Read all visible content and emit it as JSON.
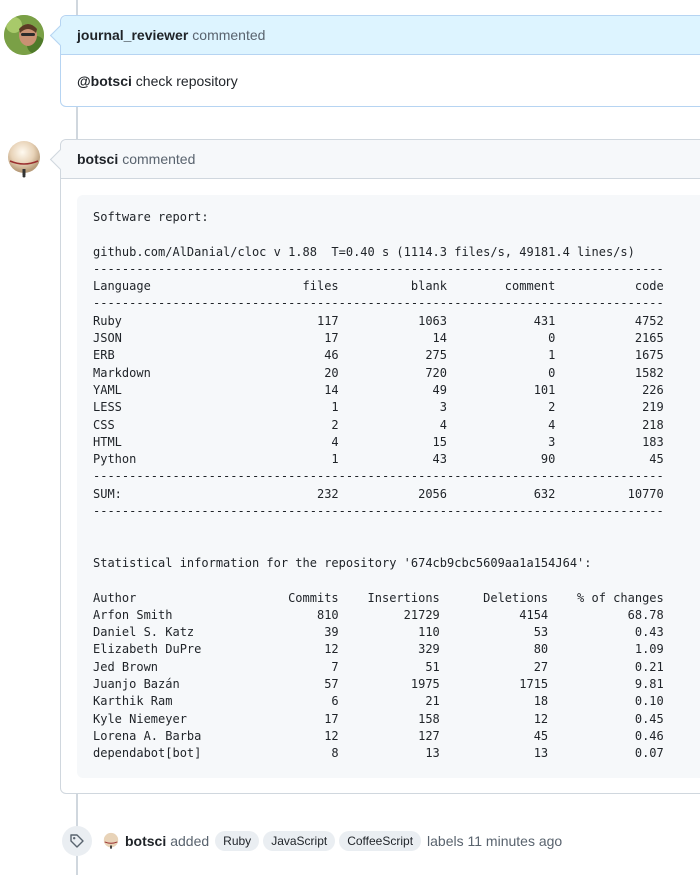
{
  "comments": [
    {
      "author": "journal_reviewer",
      "action": "commented",
      "mention": "@botsci",
      "text": " check repository"
    },
    {
      "author": "botsci",
      "action": "commented"
    }
  ],
  "report": {
    "lines": [
      "Software report:",
      "",
      "github.com/AlDanial/cloc v 1.88  T=0.40 s (1114.3 files/s, 49181.4 lines/s)",
      "-------------------------------------------------------------------------------",
      "Language                     files          blank        comment           code",
      "-------------------------------------------------------------------------------",
      "Ruby                           117           1063            431           4752",
      "JSON                            17             14              0           2165",
      "ERB                             46            275              1           1675",
      "Markdown                        20            720              0           1582",
      "YAML                            14             49            101            226",
      "LESS                             1              3              2            219",
      "CSS                              2              4              4            218",
      "HTML                             4             15              3            183",
      "Python                           1             43             90             45",
      "-------------------------------------------------------------------------------",
      "SUM:                           232           2056            632          10770",
      "-------------------------------------------------------------------------------",
      "",
      "",
      "Statistical information for the repository '674cb9cbc5609aa1a154J64':",
      "",
      "Author                     Commits    Insertions      Deletions    % of changes",
      "Arfon Smith                    810         21729           4154           68.78",
      "Daniel S. Katz                  39           110             53            0.43",
      "Elizabeth DuPre                 12           329             80            1.09",
      "Jed Brown                        7            51             27            0.21",
      "Juanjo Bazán                    57          1975           1715            9.81",
      "Karthik Ram                      6            21             18            0.10",
      "Kyle Niemeyer                   17           158             12            0.45",
      "Lorena A. Barba                 12           127             45            0.46",
      "dependabot[bot]                  8            13             13            0.07"
    ]
  },
  "event": {
    "author": "botsci",
    "action": "added",
    "labels": [
      "Ruby",
      "JavaScript",
      "CoffeeScript"
    ],
    "tail": "labels 11 minutes ago",
    "icon": "tag-icon"
  },
  "colors": {
    "highlight_header": "#ddf4ff",
    "normal_header": "#f6f8fa",
    "code_bg": "#f6f8fa"
  }
}
